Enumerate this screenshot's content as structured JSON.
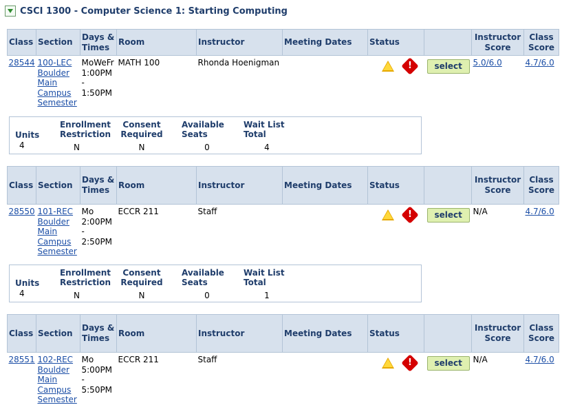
{
  "course_title": "CSCI 1300 - Computer Science 1: Starting Computing",
  "headers": {
    "class": "Class",
    "section": "Section",
    "days_times_wrap": "Days & Times",
    "room": "Room",
    "instructor": "Instructor",
    "meeting_dates": "Meeting Dates",
    "status": "Status",
    "instructor_score": "Instructor Score",
    "class_score": "Class Score"
  },
  "detail_headers": {
    "units": "Units",
    "enrollment_restriction": "Enrollment Restriction",
    "consent_required": "Consent Required",
    "available_seats": "Available Seats",
    "wait_list_total": "Wait List Total"
  },
  "sections": [
    {
      "class_nbr": "28544",
      "section_code": "100-LEC",
      "campus": "Boulder Main Campus",
      "session": "Semester",
      "days": "MoWeFr",
      "start": "1:00PM",
      "dash": "-",
      "end": "1:50PM",
      "room": "MATH 100",
      "instructor": "Rhonda Hoenigman",
      "meeting_dates": "",
      "select_label": "select",
      "instructor_score": "5.0/6.0",
      "class_score": "4.7/6.0",
      "units": "4",
      "enrollment_restriction": "N",
      "consent_required": "N",
      "available_seats": "0",
      "wait_list_total": "4"
    },
    {
      "class_nbr": "28550",
      "section_code": "101-REC",
      "campus": "Boulder Main Campus",
      "session": "Semester",
      "days": "Mo",
      "start": "2:00PM",
      "dash": "-",
      "end": "2:50PM",
      "room": "ECCR 211",
      "instructor": "Staff",
      "meeting_dates": "",
      "select_label": "select",
      "instructor_score": "N/A",
      "class_score": "4.7/6.0",
      "units": "4",
      "enrollment_restriction": "N",
      "consent_required": "N",
      "available_seats": "0",
      "wait_list_total": "1"
    },
    {
      "class_nbr": "28551",
      "section_code": "102-REC",
      "campus": "Boulder Main Campus",
      "session": "Semester",
      "days": "Mo",
      "start": "5:00PM",
      "dash": "-",
      "end": "5:50PM",
      "room": "ECCR 211",
      "instructor": "Staff",
      "meeting_dates": "",
      "select_label": "select",
      "instructor_score": "N/A",
      "class_score": "4.7/6.0"
    }
  ],
  "icons": {
    "warning": "warning-triangle-icon",
    "error": "error-diamond-icon",
    "toggle": "collapse-toggle-icon"
  }
}
